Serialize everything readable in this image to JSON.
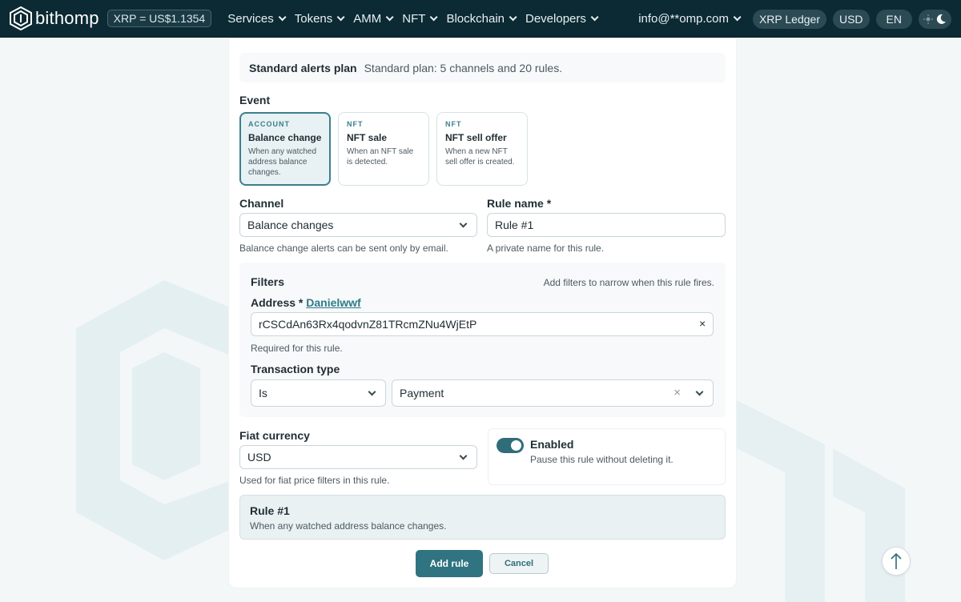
{
  "header": {
    "logo_text": "bithomp",
    "price": "XRP = US$1.1354",
    "nav": [
      {
        "label": "Services"
      },
      {
        "label": "Tokens"
      },
      {
        "label": "AMM"
      },
      {
        "label": "NFT"
      },
      {
        "label": "Blockchain"
      },
      {
        "label": "Developers"
      }
    ],
    "email": "info@**omp.com",
    "network": "XRP Ledger",
    "currency": "USD",
    "language": "EN"
  },
  "plan": {
    "title": "Standard alerts plan",
    "description": "Standard plan: 5 channels and 20 rules."
  },
  "event": {
    "label": "Event",
    "options": [
      {
        "tag": "ACCOUNT",
        "name": "Balance change",
        "description": "When any watched address balance changes.",
        "selected": true
      },
      {
        "tag": "NFT",
        "name": "NFT sale",
        "description": "When an NFT sale is detected.",
        "selected": false
      },
      {
        "tag": "NFT",
        "name": "NFT sell offer",
        "description": "When a new NFT sell offer is created.",
        "selected": false
      }
    ]
  },
  "channel": {
    "label": "Channel",
    "value": "Balance changes",
    "help": "Balance change alerts can be sent only by email."
  },
  "rule_name": {
    "label": "Rule name *",
    "value": "Rule #1",
    "help": "A private name for this rule."
  },
  "filters": {
    "title": "Filters",
    "hint": "Add filters to narrow when this rule fires.",
    "address_label": "Address *",
    "address_link": "Danielwwf",
    "address_value": "rCSCdAn63Rx4qodvnZ81TRcmZNu4WjEtP",
    "address_clear": "×",
    "address_help": "Required for this rule.",
    "tx_type_label": "Transaction type",
    "tx_operator": "Is",
    "tx_value": "Payment",
    "tx_clear": "×"
  },
  "fiat": {
    "label": "Fiat currency",
    "value": "USD",
    "help": "Used for fiat price filters in this rule."
  },
  "enabled": {
    "label": "Enabled",
    "help": "Pause this rule without deleting it.",
    "on": true
  },
  "summary": {
    "title": "Rule #1",
    "description": "When any watched address balance changes."
  },
  "actions": {
    "add": "Add rule",
    "cancel": "Cancel"
  },
  "colors": {
    "header_bg": "#0b2a33",
    "accent": "#2f7480",
    "selected_card_bg": "#e8f1f3"
  }
}
